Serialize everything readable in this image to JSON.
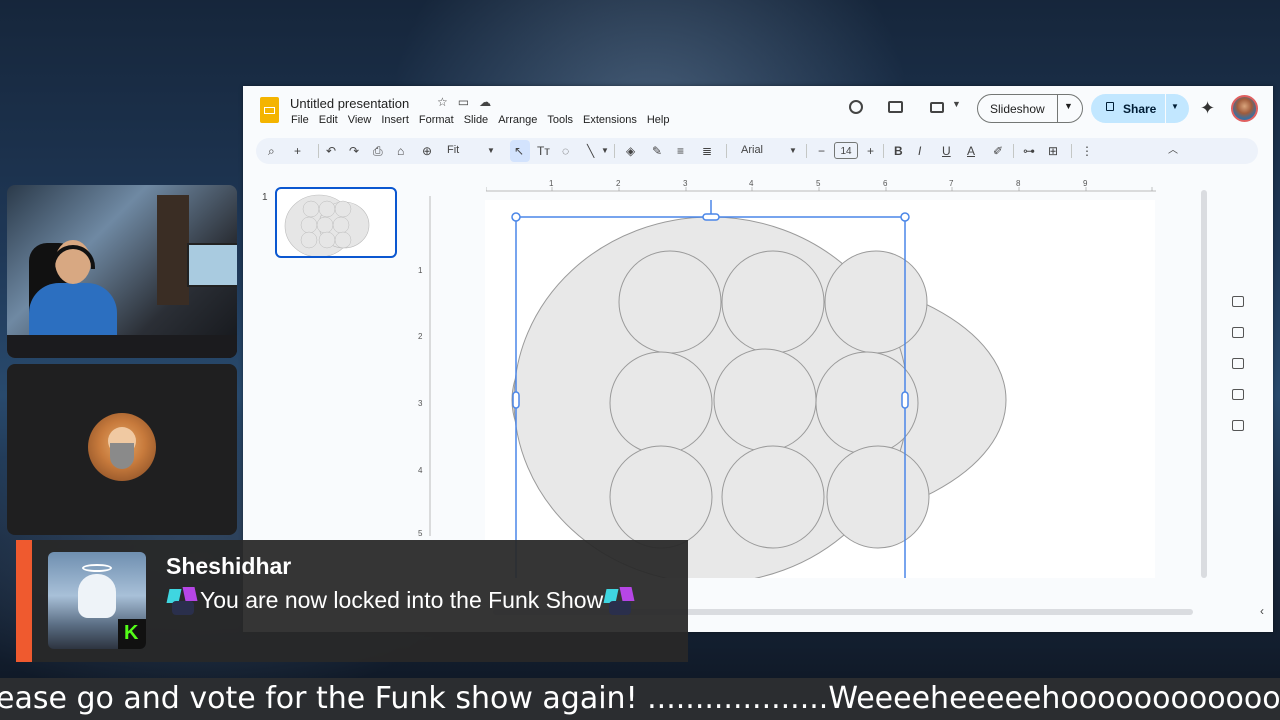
{
  "app": {
    "doc_title": "Untitled presentation",
    "menu": [
      "File",
      "Edit",
      "View",
      "Insert",
      "Format",
      "Slide",
      "Arrange",
      "Tools",
      "Extensions",
      "Help"
    ],
    "slideshow_label": "Slideshow",
    "share_label": "Share",
    "toolbar": {
      "zoom": "Fit",
      "font": "Arial",
      "font_size": "14",
      "bold": "B",
      "italic": "I",
      "underline": "U",
      "text_color": "A"
    },
    "slide_number": "1",
    "ruler_h": [
      "1",
      "2",
      "3",
      "4",
      "5",
      "6",
      "7",
      "8",
      "9"
    ],
    "ruler_v": [
      "1",
      "2",
      "3",
      "4",
      "5"
    ],
    "accent_color": "#0b57d0"
  },
  "alert": {
    "username": "Sheshidhar",
    "message": "You are now locked into the Funk Show",
    "bar_color": "#ef5a2f"
  },
  "ticker": {
    "text": "ease go and vote for the Funk show again! ...................Weeeeheeeeehooooooooooooo"
  }
}
